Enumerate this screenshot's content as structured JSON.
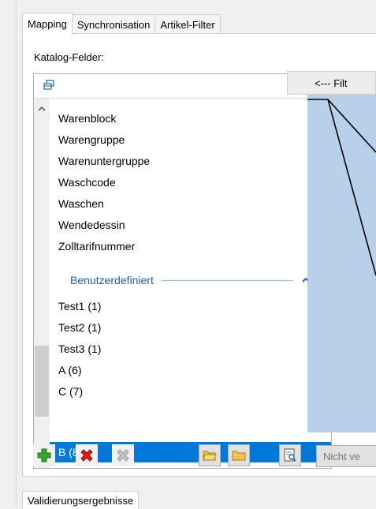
{
  "tabs": [
    {
      "label": "Mapping",
      "active": true
    },
    {
      "label": "Synchronisation",
      "active": false
    },
    {
      "label": "Artikel-Filter",
      "active": false
    }
  ],
  "catalog": {
    "label": "Katalog-Felder:",
    "items": [
      "Warenblock",
      "Warengruppe",
      "Warenuntergruppe",
      "Waschcode",
      "Waschen",
      "Wendedessin",
      "Zolltarifnummer"
    ],
    "group": {
      "label": "Benutzerdefiniert",
      "items": [
        "Test1 (1)",
        "Test2 (1)",
        "Test3 (1)",
        "A (6)",
        "C (7)",
        "B (8)"
      ],
      "selected": "B (8)"
    }
  },
  "mapping": {
    "header_label": "<--- Filt"
  },
  "toolbar": {
    "not_mapped_label": "Nicht ve"
  },
  "bottom_tab": {
    "label": "Validierungsergebnisse"
  },
  "colors": {
    "selection": "#0078d7",
    "mapping_area": "#b8d0ea",
    "group_header": "#1a5fb4"
  },
  "icons": [
    "collapse-all-icon",
    "scroll-up-icon",
    "scroll-down-icon",
    "chevron-up-icon",
    "add-icon",
    "delete-icon",
    "delete-disabled-icon",
    "folder-open-icon",
    "folder-icon",
    "preview-icon"
  ]
}
